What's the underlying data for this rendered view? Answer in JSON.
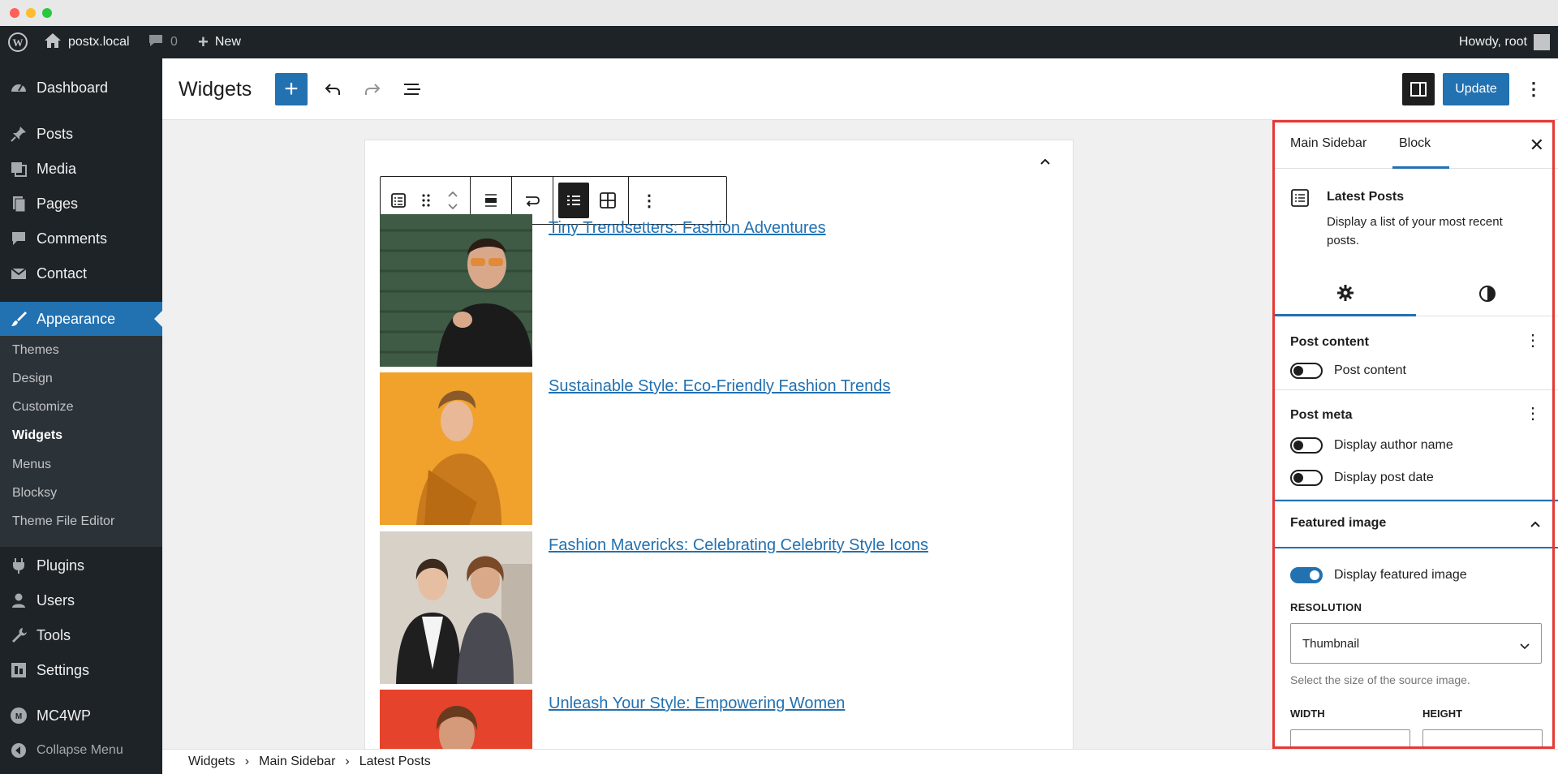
{
  "admin_bar": {
    "site_name": "postx.local",
    "comments_count": "0",
    "new_label": "New",
    "howdy": "Howdy, root"
  },
  "sidebar": {
    "items": [
      {
        "label": "Dashboard",
        "icon": "dashboard-icon"
      },
      {
        "label": "Posts",
        "icon": "pin-icon"
      },
      {
        "label": "Media",
        "icon": "media-icon"
      },
      {
        "label": "Pages",
        "icon": "pages-icon"
      },
      {
        "label": "Comments",
        "icon": "comment-icon"
      },
      {
        "label": "Contact",
        "icon": "mail-icon"
      },
      {
        "label": "Appearance",
        "icon": "brush-icon"
      }
    ],
    "submenu": [
      "Themes",
      "Design",
      "Customize",
      "Widgets",
      "Menus",
      "Blocksy",
      "Theme File Editor"
    ],
    "lower_items": [
      {
        "label": "Plugins",
        "icon": "plug-icon"
      },
      {
        "label": "Users",
        "icon": "user-icon"
      },
      {
        "label": "Tools",
        "icon": "wrench-icon"
      },
      {
        "label": "Settings",
        "icon": "settings-icon"
      },
      {
        "label": "MC4WP",
        "icon": "mc4wp-icon"
      }
    ],
    "collapse": "Collapse Menu",
    "accent": "#2271b1"
  },
  "header": {
    "title": "Widgets",
    "update_label": "Update"
  },
  "posts": [
    {
      "title": "Tiny Trendsetters: Fashion Adventures"
    },
    {
      "title": "Sustainable Style: Eco-Friendly Fashion Trends"
    },
    {
      "title": "Fashion Mavericks: Celebrating Celebrity Style Icons"
    },
    {
      "title": "Unleash Your Style: Empowering Women"
    }
  ],
  "settings": {
    "tab_main": "Main Sidebar",
    "tab_block": "Block",
    "block_name": "Latest Posts",
    "block_desc": "Display a list of your most recent posts.",
    "post_content_title": "Post content",
    "post_content_toggle": "Post content",
    "post_meta_title": "Post meta",
    "author_toggle": "Display author name",
    "date_toggle": "Display post date",
    "featured_title": "Featured image",
    "featured_toggle": "Display featured image",
    "resolution_label": "RESOLUTION",
    "resolution_value": "Thumbnail",
    "resolution_help": "Select the size of the source image.",
    "width_label": "WIDTH",
    "height_label": "HEIGHT"
  },
  "breadcrumb": [
    "Widgets",
    "Main Sidebar",
    "Latest Posts"
  ]
}
